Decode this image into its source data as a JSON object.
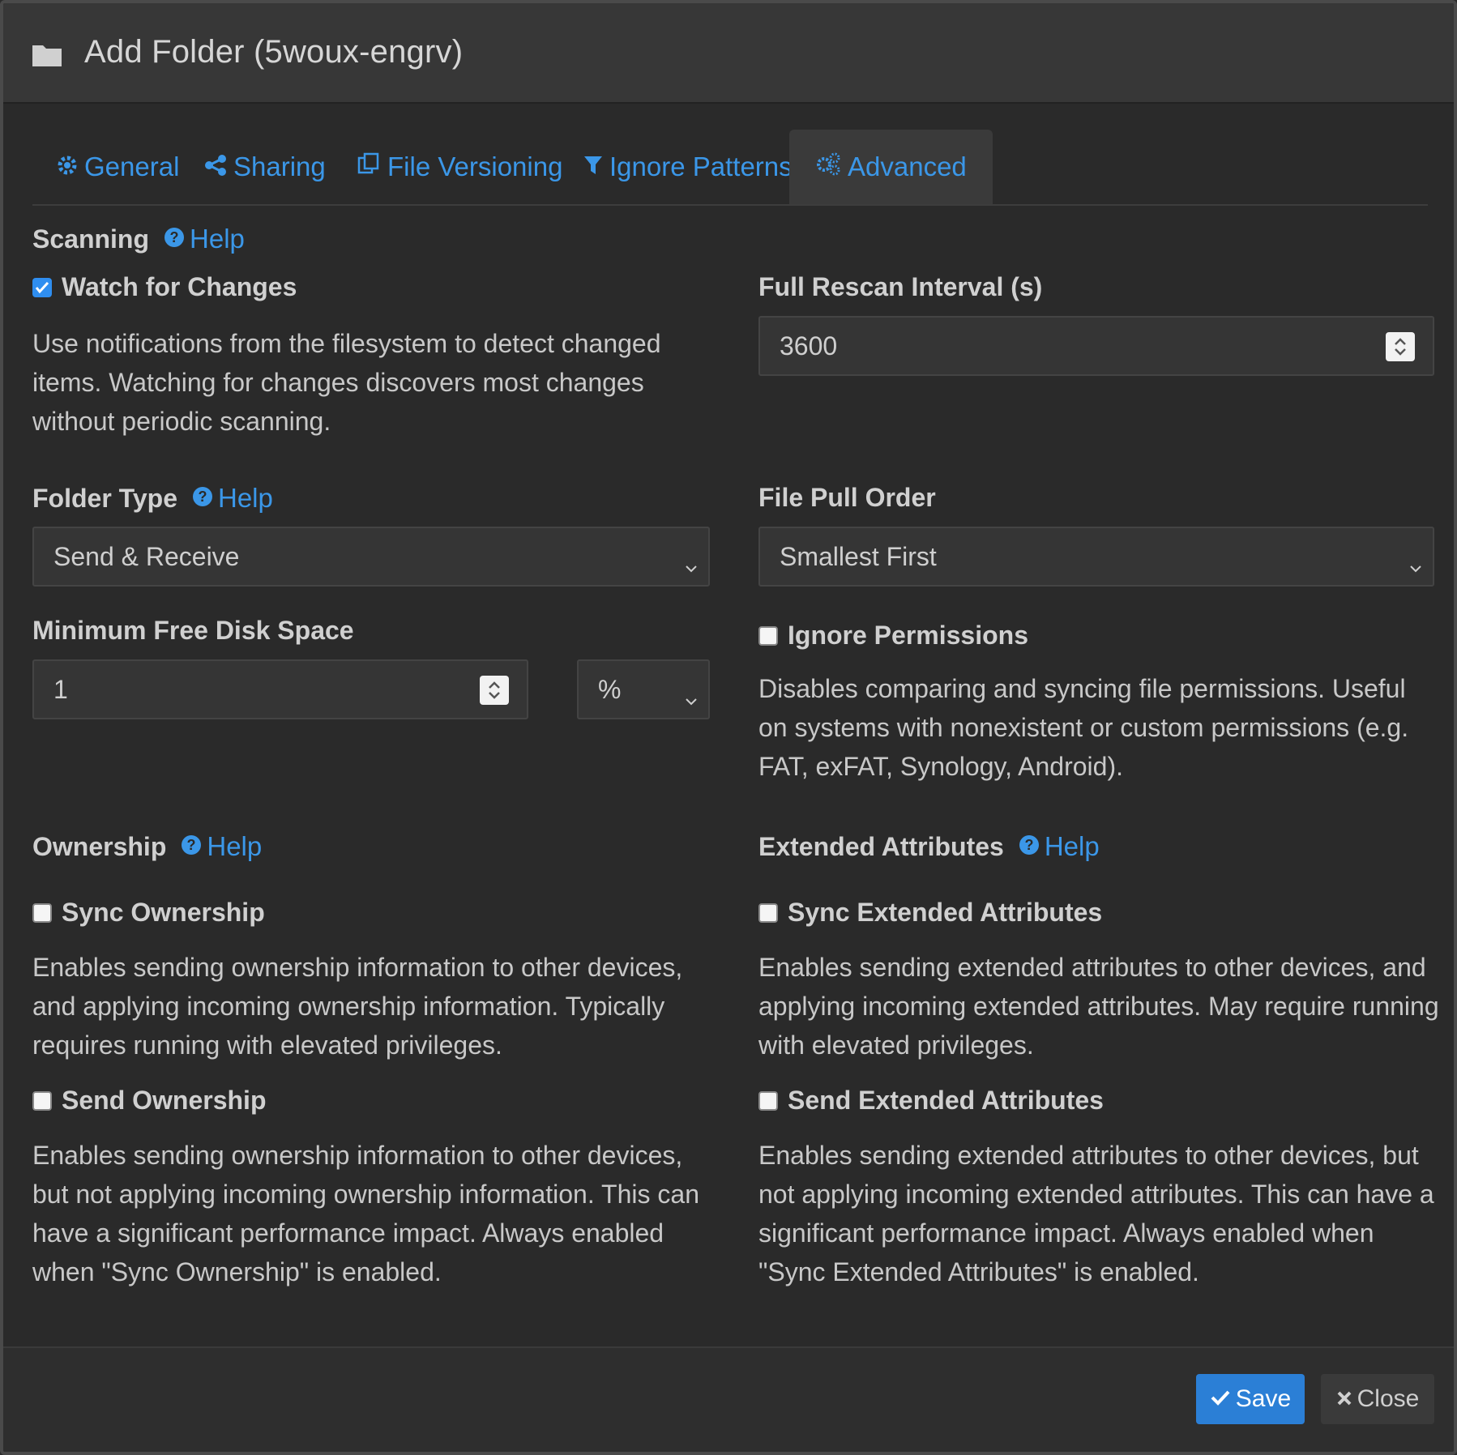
{
  "dialog": {
    "title": "Add Folder (5woux-engrv)",
    "icon": "folder-icon"
  },
  "tabs": [
    {
      "label": "General",
      "icon": "gear-icon"
    },
    {
      "label": "Sharing",
      "icon": "share-icon"
    },
    {
      "label": "File Versioning",
      "icon": "copy-icon"
    },
    {
      "label": "Ignore Patterns",
      "icon": "filter-icon"
    },
    {
      "label": "Advanced",
      "icon": "gears-icon",
      "active": true
    }
  ],
  "scanning": {
    "heading": "Scanning",
    "help": "Help",
    "watch_label": "Watch for Changes",
    "watch_checked": true,
    "watch_desc": "Use notifications from the filesystem to detect changed items. Watching for changes discovers most changes without periodic scanning.",
    "rescan_label": "Full Rescan Interval (s)",
    "rescan_value": "3600"
  },
  "folder_type": {
    "heading": "Folder Type",
    "help": "Help",
    "value": "Send & Receive"
  },
  "pull_order": {
    "heading": "File Pull Order",
    "value": "Smallest First"
  },
  "disk": {
    "heading": "Minimum Free Disk Space",
    "value": "1",
    "unit": "%"
  },
  "permissions": {
    "label": "Ignore Permissions",
    "checked": false,
    "desc": "Disables comparing and syncing file permissions. Useful on systems with nonexistent or custom permissions (e.g. FAT, exFAT, Synology, Android)."
  },
  "ownership": {
    "heading": "Ownership",
    "help": "Help",
    "sync_label": "Sync Ownership",
    "sync_desc": "Enables sending ownership information to other devices, and applying incoming ownership information. Typically requires running with elevated privileges.",
    "send_label": "Send Ownership",
    "send_desc": "Enables sending ownership information to other devices, but not applying incoming ownership information. This can have a significant performance impact. Always enabled when \"Sync Ownership\" is enabled."
  },
  "xattrs": {
    "heading": "Extended Attributes",
    "help": "Help",
    "sync_label": "Sync Extended Attributes",
    "sync_desc": "Enables sending extended attributes to other devices, and applying incoming extended attributes. May require running with elevated privileges.",
    "send_label": "Send Extended Attributes",
    "send_desc": "Enables sending extended attributes to other devices, but not applying incoming extended attributes. This can have a significant performance impact. Always enabled when \"Sync Extended Attributes\" is enabled."
  },
  "footer": {
    "save": "Save",
    "close": "Close"
  },
  "colors": {
    "accent": "#3b97e8",
    "save_bg": "#2b7fd6"
  }
}
